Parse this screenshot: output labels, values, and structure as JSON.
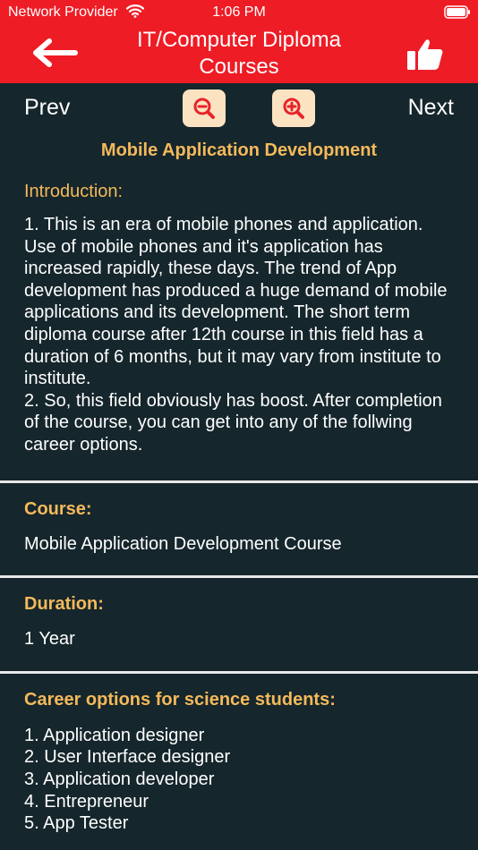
{
  "status_bar": {
    "carrier": "Network Provider",
    "time": "1:06 PM",
    "wifi_icon": "wifi-icon",
    "battery_icon": "battery-icon"
  },
  "header": {
    "title_line1": "IT/Computer Diploma",
    "title_line2": "Courses",
    "back_icon": "back-arrow-icon",
    "like_icon": "thumbs-up-icon",
    "background_color": "#ee1c25"
  },
  "toolbar": {
    "prev_label": "Prev",
    "next_label": "Next",
    "zoom_out_icon": "zoom-out-icon",
    "zoom_in_icon": "zoom-in-icon",
    "button_bg": "#fbe3c2"
  },
  "course": {
    "name": "Mobile Application Development"
  },
  "introduction": {
    "heading": "Introduction:",
    "paragraph1": "1. This is an era of mobile phones and application. Use of mobile phones and it's application has increased rapidly, these days. The trend of App development has produced a huge demand of mobile applications and its development. The short term diploma course after 12th course in this field has a duration of 6 months, but it may vary from institute to institute.",
    "paragraph2": "2. So, this field obviously has boost. After completion of the course, you can get into any of the follwing career options."
  },
  "course_section": {
    "heading": "Course:",
    "value": "Mobile Application Development Course"
  },
  "duration_section": {
    "heading": "Duration:",
    "value": "1 Year"
  },
  "career_section": {
    "heading": "Career options for science students:",
    "items": [
      "1. Application designer",
      "2. User Interface designer",
      "3. Application developer",
      "4. Entrepreneur",
      "5. App Tester"
    ]
  },
  "colors": {
    "background": "#15262c",
    "accent": "#f4b95b",
    "divider": "#e8e8e8"
  }
}
